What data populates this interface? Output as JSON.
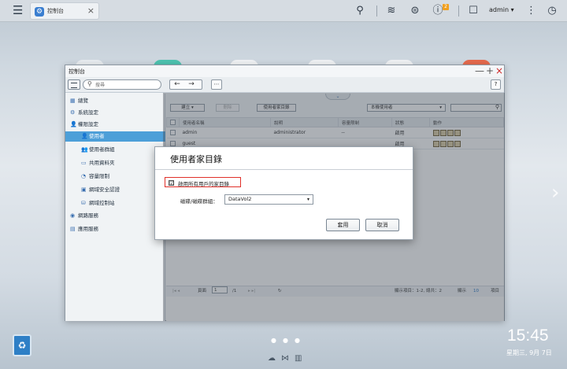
{
  "topbar": {
    "tab_label": "控制台",
    "user": "admin ▾",
    "notification_count": "2"
  },
  "window": {
    "title": "控制台",
    "search_placeholder": "搜尋",
    "help": "?",
    "minimize": "—",
    "maximize": "+",
    "close": "×"
  },
  "sidebar": {
    "items": [
      {
        "label": "總覽",
        "icon": "overview-icon"
      },
      {
        "label": "系統設定",
        "icon": "gear-icon"
      },
      {
        "label": "權限設定",
        "icon": "user-icon"
      },
      {
        "label": "使用者",
        "icon": "user-icon"
      },
      {
        "label": "使用者群組",
        "icon": "group-icon"
      },
      {
        "label": "共用資料夾",
        "icon": "folder-icon"
      },
      {
        "label": "容量限制",
        "icon": "quota-icon"
      },
      {
        "label": "網域安全認證",
        "icon": "domain-icon"
      },
      {
        "label": "網域控制站",
        "icon": "dc-icon"
      },
      {
        "label": "網路服務",
        "icon": "network-icon"
      },
      {
        "label": "應用服務",
        "icon": "app-icon"
      }
    ]
  },
  "main": {
    "create_btn": "建立 ▾",
    "delete_btn": "刪除",
    "home_btn": "使用者家目錄",
    "user_type_select": "本機使用者",
    "columns": [
      "使用者名稱",
      "說明",
      "容量限制",
      "狀態",
      "動作"
    ],
    "rows": [
      {
        "name": "admin",
        "desc": "administrator",
        "quota": "--",
        "status": "啟用"
      },
      {
        "name": "guest",
        "desc": "",
        "quota": "",
        "status": "啟用"
      }
    ],
    "pager": {
      "page_label": "頁面",
      "page_value": "1",
      "page_total": "/1",
      "display_info": "顯示項目：1-2, 總共：2",
      "show_label": "顯示",
      "per_page": "10",
      "items_label": "項目"
    }
  },
  "modal": {
    "title": "使用者家目錄",
    "checkbox_label": "啟用所有用戶的家目錄",
    "checkbox_checked": "☑",
    "volume_label": "磁碟/磁碟群組：",
    "volume_value": "DataVol2",
    "apply_btn": "套用",
    "cancel_btn": "取消"
  },
  "desktop": {
    "time": "15:45",
    "date": "星期三, 9月 7日"
  }
}
